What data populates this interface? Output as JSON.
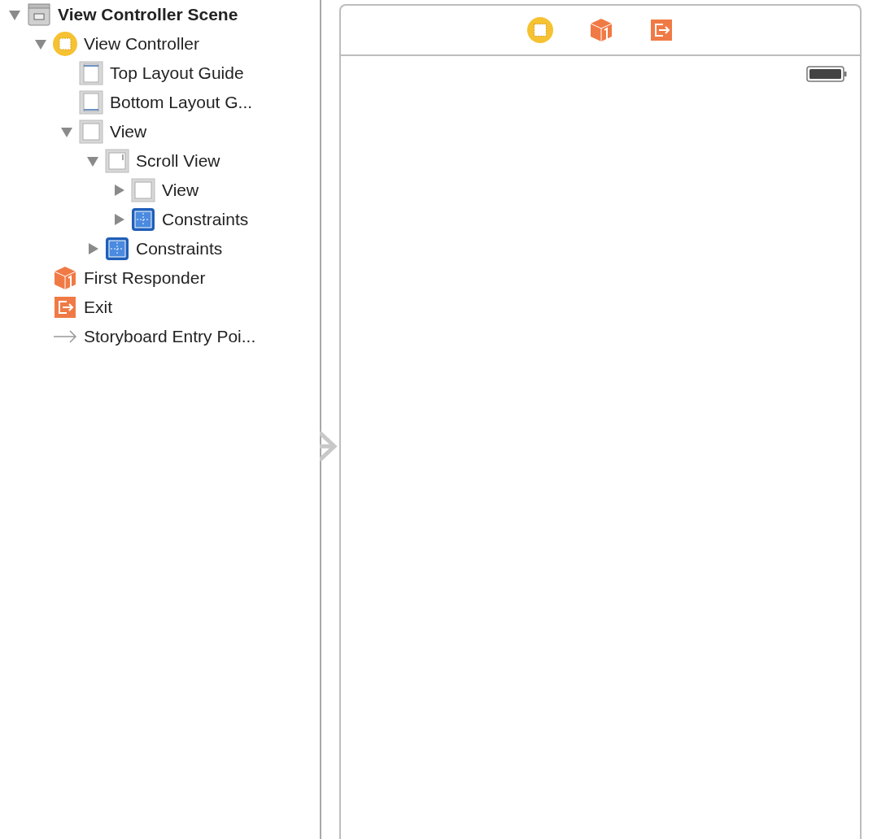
{
  "outline": [
    {
      "label": "View Controller Scene",
      "kind": "scene",
      "expanded": true,
      "children": [
        {
          "label": "View Controller",
          "kind": "view-controller",
          "expanded": true,
          "children": [
            {
              "label": "Top Layout Guide",
              "kind": "top-guide"
            },
            {
              "label": "Bottom Layout G...",
              "kind": "bottom-guide"
            },
            {
              "label": "View",
              "kind": "view",
              "expanded": true,
              "children": [
                {
                  "label": "Scroll View",
                  "kind": "scroll-view",
                  "expanded": true,
                  "children": [
                    {
                      "label": "View",
                      "kind": "view",
                      "expanded": false
                    },
                    {
                      "label": "Constraints",
                      "kind": "constraints",
                      "expanded": false
                    }
                  ]
                },
                {
                  "label": "Constraints",
                  "kind": "constraints",
                  "expanded": false
                }
              ]
            }
          ]
        },
        {
          "label": "First Responder",
          "kind": "responder"
        },
        {
          "label": "Exit",
          "kind": "exit"
        },
        {
          "label": "Storyboard Entry Poi...",
          "kind": "entry"
        }
      ]
    }
  ]
}
